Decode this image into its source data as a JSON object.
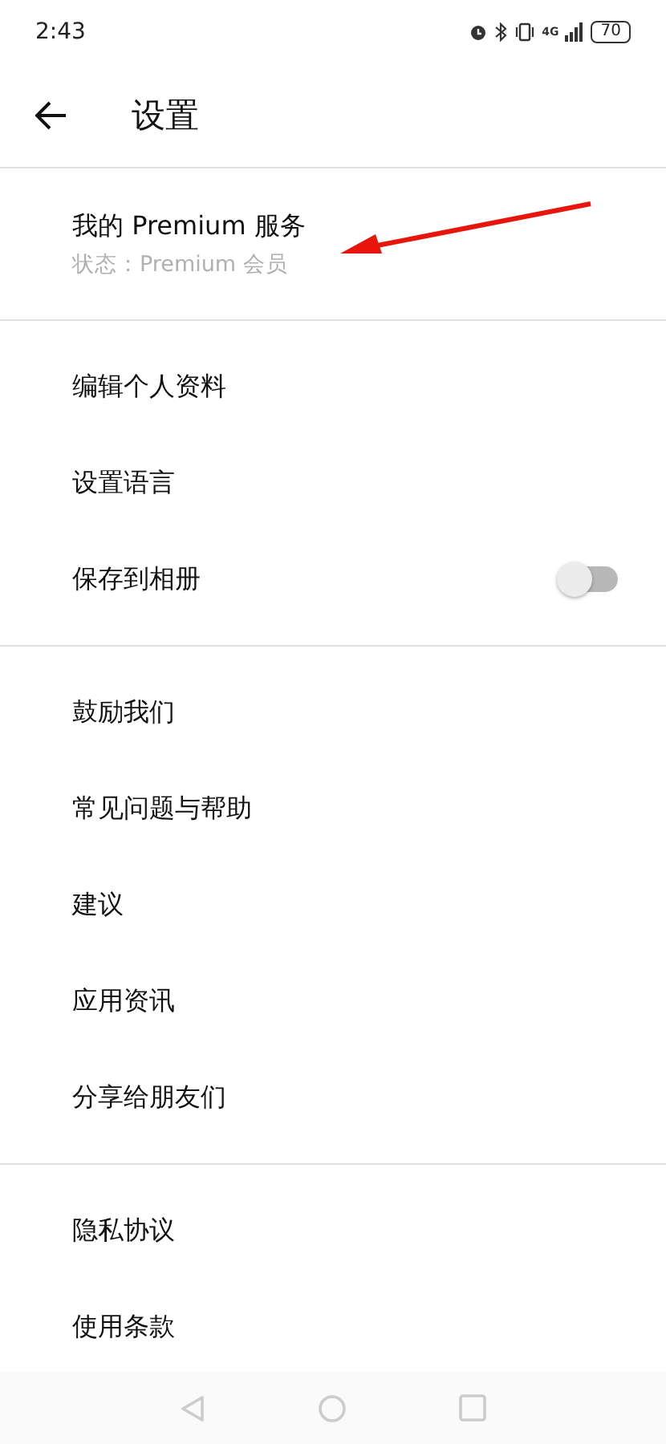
{
  "status_bar": {
    "time": "2:43",
    "network": "4G",
    "battery": "70"
  },
  "header": {
    "title": "设置"
  },
  "premium": {
    "title": "我的 Premium 服务",
    "status": "状态：Premium 会员"
  },
  "groups": [
    {
      "items": [
        {
          "label": "编辑个人资料",
          "kind": "link"
        },
        {
          "label": "设置语言",
          "kind": "link"
        },
        {
          "label": "保存到相册",
          "kind": "toggle",
          "on": false
        }
      ]
    },
    {
      "items": [
        {
          "label": "鼓励我们",
          "kind": "link"
        },
        {
          "label": "常见问题与帮助",
          "kind": "link"
        },
        {
          "label": "建议",
          "kind": "link"
        },
        {
          "label": "应用资讯",
          "kind": "link"
        },
        {
          "label": "分享给朋友们",
          "kind": "link"
        }
      ]
    },
    {
      "items": [
        {
          "label": "隐私协议",
          "kind": "link"
        },
        {
          "label": "使用条款",
          "kind": "link"
        }
      ]
    }
  ]
}
